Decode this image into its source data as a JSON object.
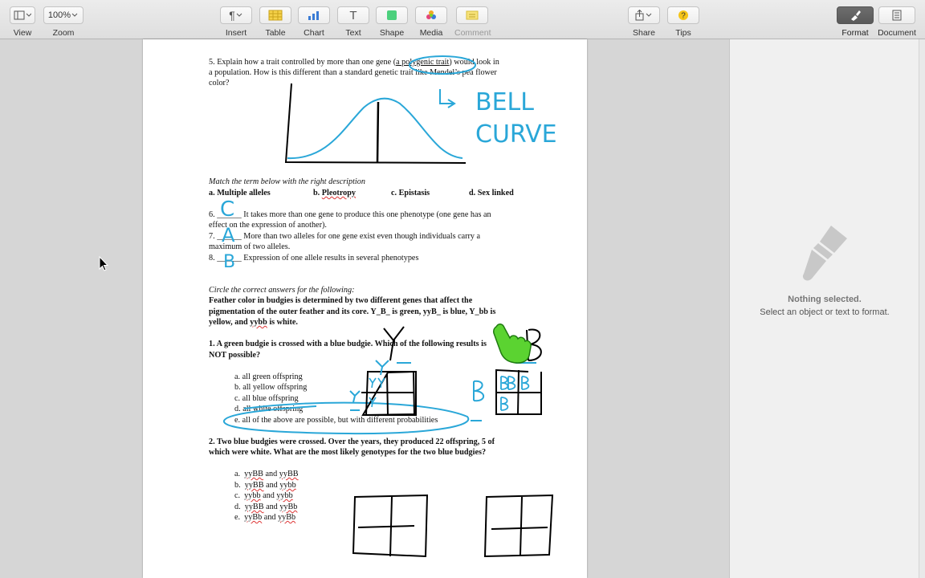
{
  "toolbar": {
    "view": "View",
    "zoom_value": "100%",
    "zoom": "Zoom",
    "insert": "Insert",
    "table": "Table",
    "chart": "Chart",
    "text": "Text",
    "shape": "Shape",
    "media": "Media",
    "comment": "Comment",
    "share": "Share",
    "tips": "Tips",
    "format": "Format",
    "document": "Document"
  },
  "doc": {
    "q5_line1a": "5.  Explain how a trait controlled by more than one gene (",
    "q5_poly": "a polygenic trait",
    "q5_line1b": ") would look in",
    "q5_line2": "a population.  How is this different than a standard genetic trait like Mendel’s pea flower",
    "q5_line3": "color?",
    "match_title": "Match the term below with the right description",
    "term_a": "a.  Multiple alleles",
    "term_b_pre": "b.  ",
    "term_b_word": "Pleotropy",
    "term_c": "c.  Epistasis",
    "term_d": "d.  Sex linked",
    "q6a": "6. ______  It takes more than one gene to produce this one phenotype (one gene has an",
    "q6b": "effect on the expression of another).",
    "q7a": "7. ______  More than two alleles for one gene exist even though individuals carry a",
    "q7b": "maximum of two alleles.",
    "q8": "8. ______  Expression of one allele results in several phenotypes",
    "circle_title": "Circle the correct answers for the following:",
    "feather1": "Feather color in budgies is determined by two different genes that affect the",
    "feather2": "pigmentation of the outer feather and its core.  Y_B_ is green, yyB_ is blue, Y_bb is",
    "feather3a": "yellow, and ",
    "feather3_word": "yybb",
    "feather3b": " is white.",
    "q1a": "1.   A green budgie is crossed with a blue budgie.  Which of the following results is",
    "q1b": "NOT possible?",
    "q1_opts": [
      "a.  all green offspring",
      "b.   all yellow offspring",
      "c.  all blue offspring",
      "d.  all white offspring",
      "e.   all of the above are possible, but with different probabilities"
    ],
    "q2a": "2.  Two blue budgies were crossed.  Over the years, they produced 22 offspring, 5 of",
    "q2b": "which were white.  What are the most likely genotypes for the two blue budgies?",
    "q2_opts": [
      {
        "letter": "a.",
        "g1": "yyBB",
        "and": " and ",
        "g2": "yyBB"
      },
      {
        "letter": "b.",
        "g1": "yyBB",
        "and": " and ",
        "g2": "yybb"
      },
      {
        "letter": "c.",
        "g1": "yybb",
        "and": " and ",
        "g2": "yybb"
      },
      {
        "letter": "d.",
        "g1": "yyBB",
        "and": " and ",
        "g2": "yyBb"
      },
      {
        "letter": "e.",
        "g1": "yyBb",
        "and": " and ",
        "g2": "yyBb"
      }
    ],
    "handwriting": {
      "bell": "BELL",
      "curve": "CURVE",
      "ans6": "C",
      "ans7": "A",
      "ans8": "B"
    }
  },
  "sidebar": {
    "nothing_selected": "Nothing selected.",
    "hint": "Select an object or text to format."
  },
  "colors": {
    "ink": "#2aa7d8",
    "selected_button": "#5f5f5f"
  }
}
